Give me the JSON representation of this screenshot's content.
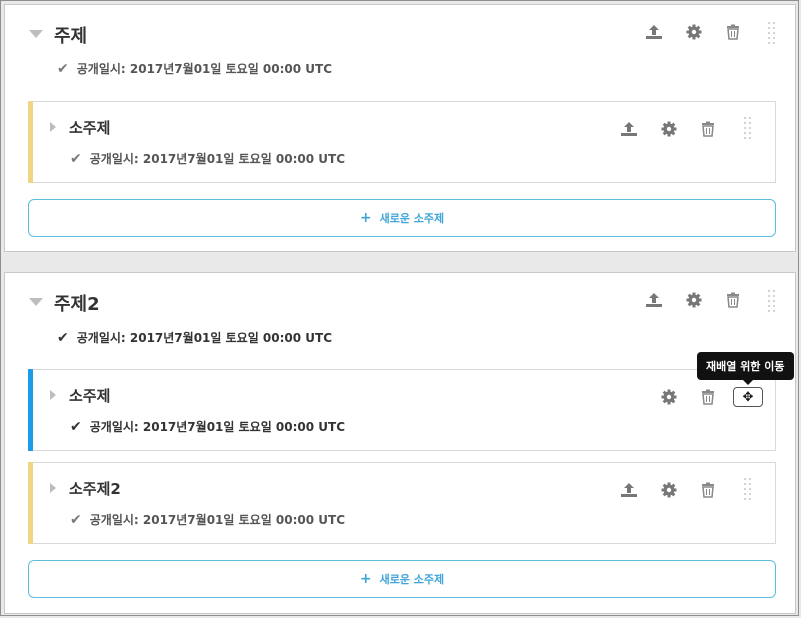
{
  "sections": [
    {
      "title": "주제",
      "published": "공개일시: 2017년7월01일 토요일 00:00 UTC",
      "subsections": [
        {
          "title": "소주제",
          "published": "공개일시: 2017년7월01일 토요일 00:00 UTC",
          "accent": "#f0d584"
        }
      ],
      "new_subsection_label": "새로운 소주제"
    },
    {
      "title": "주제2",
      "published": "공개일시: 2017년7월01일 토요일 00:00 UTC",
      "subsections": [
        {
          "title": "소주제",
          "published": "공개일시: 2017년7월01일 토요일 00:00 UTC",
          "accent": "#1e9be8"
        },
        {
          "title": "소주제2",
          "published": "공개일시: 2017년7월01일 토요일 00:00 UTC",
          "accent": "#f0d584"
        }
      ],
      "new_subsection_label": "새로운 소주제"
    }
  ],
  "tooltip": {
    "text": "재배열 위한 이동"
  },
  "icons": {
    "publish": "upload-icon",
    "settings": "gear-icon",
    "delete": "trash-icon",
    "drag": "drag-handle-icon",
    "move": "move-arrows-icon",
    "check": "check-icon",
    "expand": "caret-icon",
    "add": "plus-icon"
  },
  "colors": {
    "accent_blue": "#1e9be8",
    "accent_yellow": "#f0d584",
    "button_border": "#5bc0de",
    "button_text": "#42a5d9"
  }
}
